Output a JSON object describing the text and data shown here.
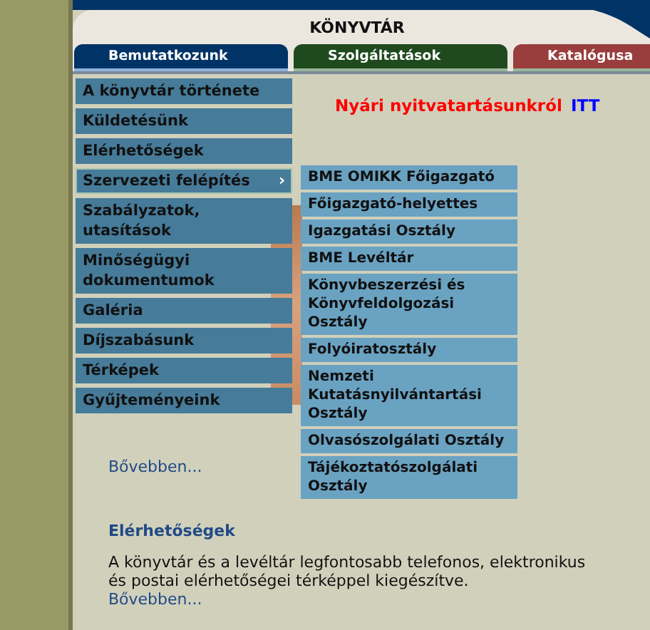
{
  "header": {
    "title": "KÖNYVTÁR"
  },
  "tabs": [
    {
      "label": "Bemutatkozunk",
      "selected": true,
      "color": "#003366"
    },
    {
      "label": "Szolgáltatások",
      "selected": false,
      "color": "#1e4a1e"
    },
    {
      "label": "Katalógusa",
      "selected": false,
      "color": "#993d3d"
    }
  ],
  "menu": [
    {
      "label": "A könyvtár története",
      "expanded": false
    },
    {
      "label": "Küldetésünk",
      "expanded": false
    },
    {
      "label": "Elérhetőségek",
      "expanded": false
    },
    {
      "label": "Szervezeti felépítés",
      "expanded": true,
      "arrow": "›",
      "children": [
        {
          "label": "BME OMIKK Főigazgató"
        },
        {
          "label": "Főigazgató-helyettes"
        },
        {
          "label": "Igazgatási Osztály"
        },
        {
          "label": "BME Levéltár"
        },
        {
          "label": "Könyvbeszerzési és Könyvfeldolgozási Osztály"
        },
        {
          "label": "Folyóiratosztály"
        },
        {
          "label": "Nemzeti Kutatásnyilvántartási Osztály"
        },
        {
          "label": "Olvasószolgálati Osztály"
        },
        {
          "label": "Tájékoztatószolgálati Osztály"
        }
      ]
    },
    {
      "label": "Szabályzatok, utasítások",
      "expanded": false
    },
    {
      "label": "Minőségügyi dokumentumok",
      "expanded": false
    },
    {
      "label": "Galéria",
      "expanded": false
    },
    {
      "label": "Díjszabásunk",
      "expanded": false
    },
    {
      "label": "Térképek",
      "expanded": false
    },
    {
      "label": "Gyűjteményeink",
      "expanded": false
    }
  ],
  "notice": {
    "text": "Nyári nyitvatartásunkról",
    "link": "ITT"
  },
  "sections": [
    {
      "more": "Bővebben..."
    },
    {
      "heading": "Elérhetőségek",
      "text": "A könyvtár és a levéltár legfontosabb telefonos, elektronikus és postai elérhetőségei térképpel kiegészítve.",
      "more": "Bővebben..."
    }
  ]
}
